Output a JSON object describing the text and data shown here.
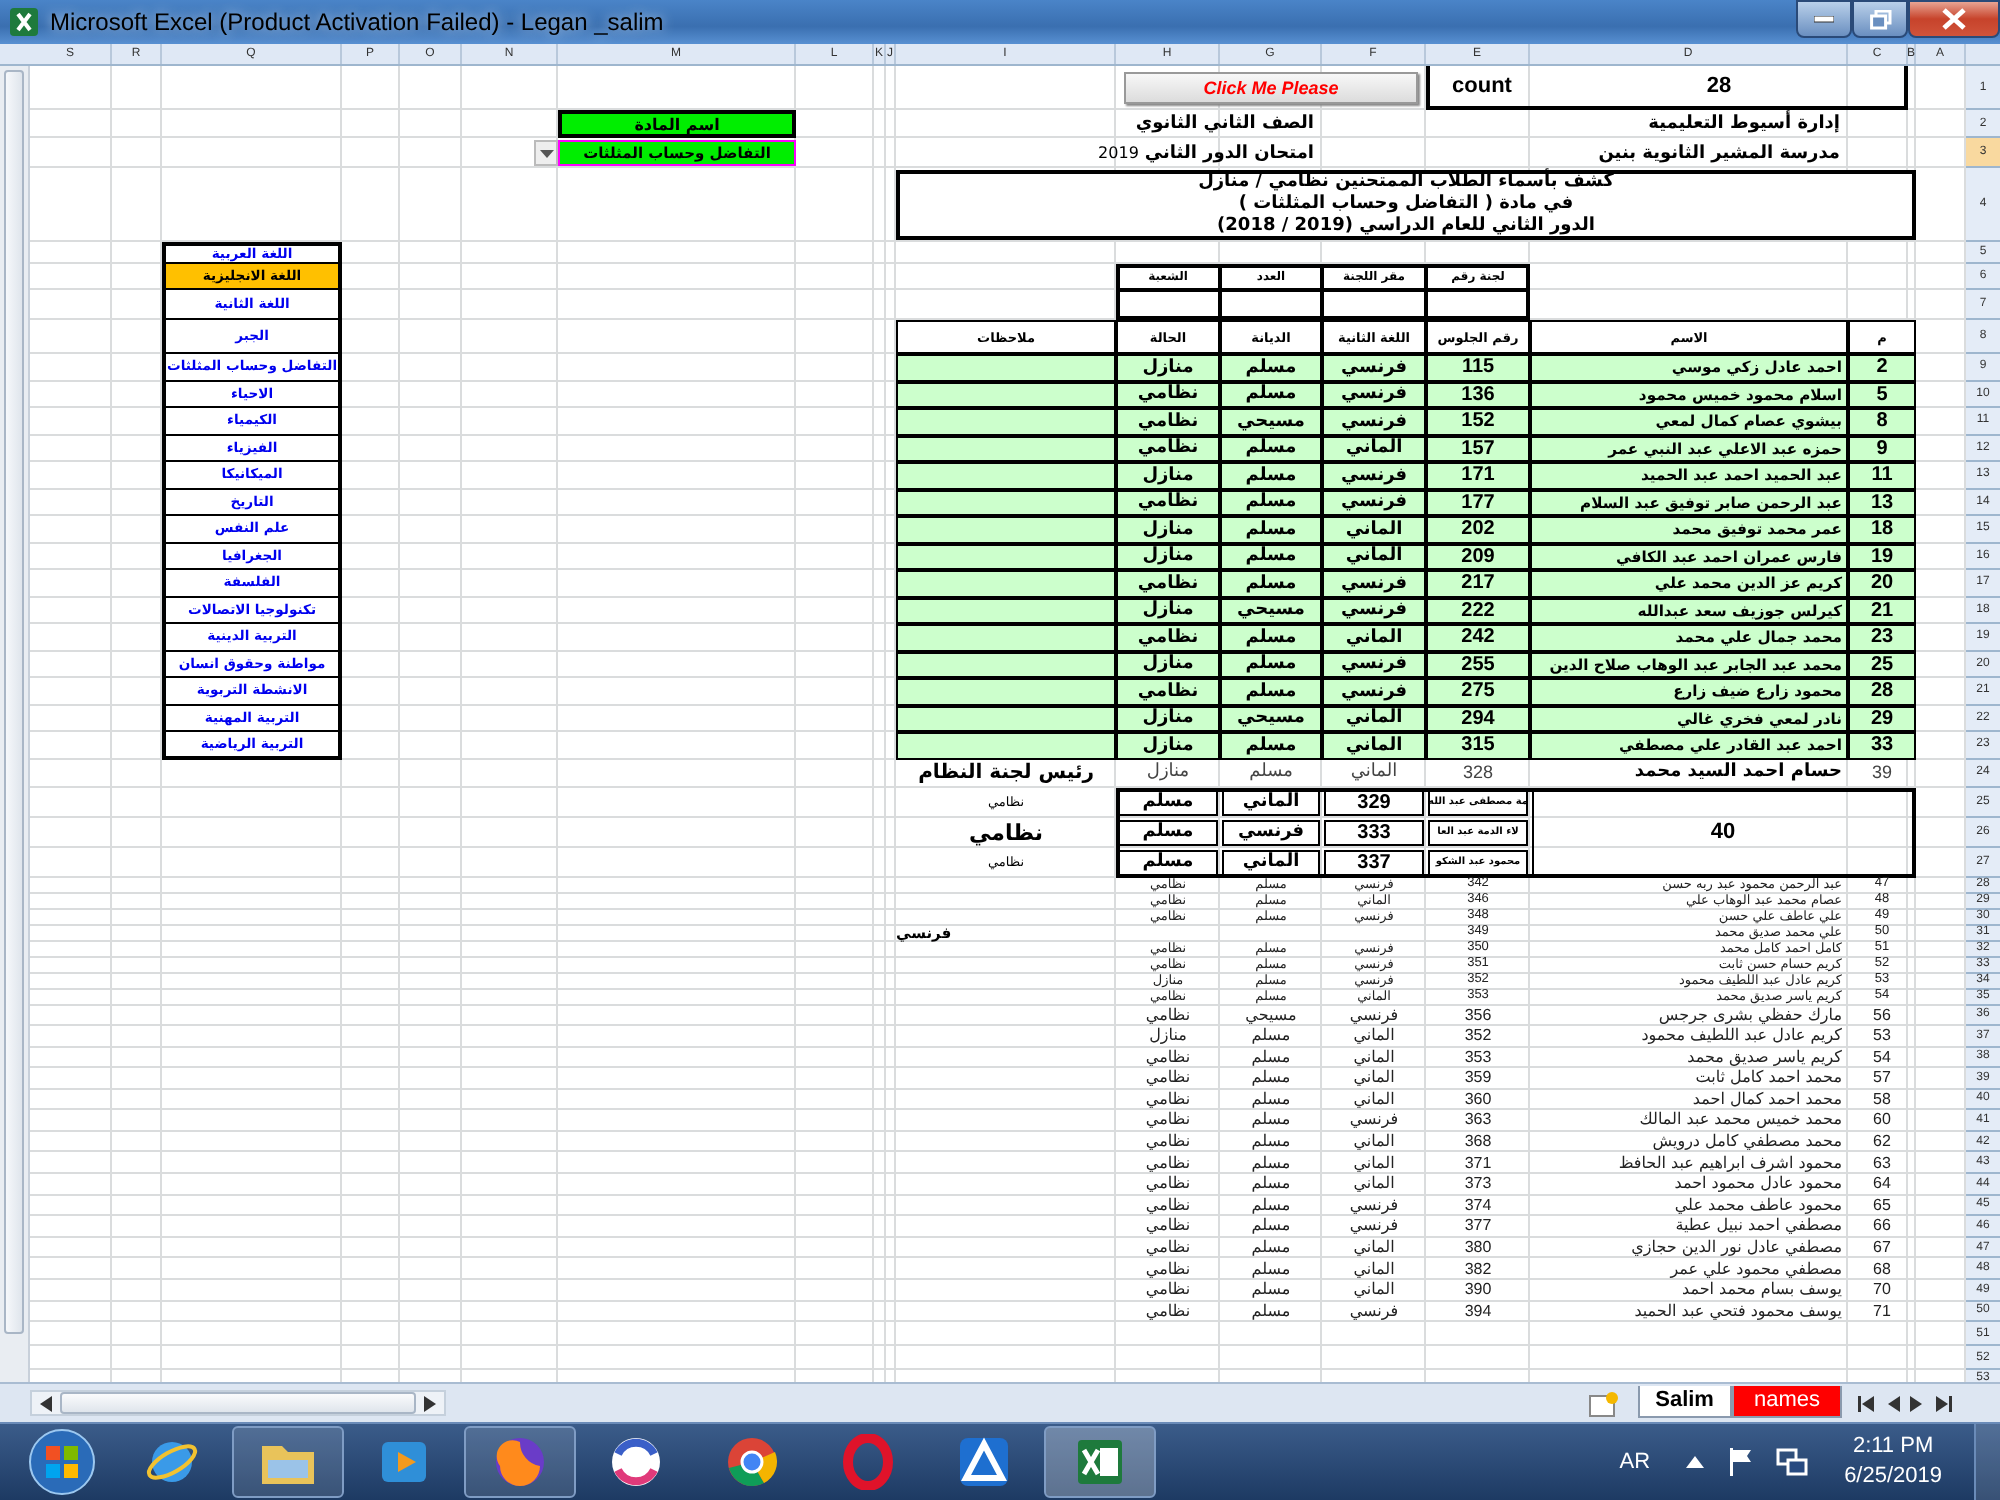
{
  "window": {
    "title": "Microsoft Excel (Product Activation Failed) - Legan _salim"
  },
  "columns": [
    "A",
    "B",
    "C",
    "D",
    "E",
    "F",
    "G",
    "H",
    "I",
    "J",
    "K",
    "L",
    "M",
    "N",
    "O",
    "P",
    "Q",
    "R",
    "S"
  ],
  "row_numbers": [
    {
      "label": "1",
      "selected": false
    },
    {
      "label": "2",
      "selected": false
    },
    {
      "label": "3",
      "selected": true
    },
    {
      "label": "4",
      "selected": false
    },
    {
      "label": "5",
      "selected": false
    },
    {
      "label": "6",
      "selected": false
    },
    {
      "label": "7",
      "selected": false
    },
    {
      "label": "8",
      "selected": false
    },
    {
      "label": "9",
      "selected": false
    },
    {
      "label": "10",
      "selected": false
    },
    {
      "label": "11",
      "selected": false
    },
    {
      "label": "12",
      "selected": false
    },
    {
      "label": "13",
      "selected": false
    },
    {
      "label": "14",
      "selected": false
    },
    {
      "label": "15",
      "selected": false
    },
    {
      "label": "16",
      "selected": false
    },
    {
      "label": "17",
      "selected": false
    },
    {
      "label": "18",
      "selected": false
    },
    {
      "label": "19",
      "selected": false
    },
    {
      "label": "20",
      "selected": false
    },
    {
      "label": "21",
      "selected": false
    },
    {
      "label": "22",
      "selected": false
    },
    {
      "label": "23",
      "selected": false
    },
    {
      "label": "24",
      "selected": false
    },
    {
      "label": "25",
      "selected": false
    },
    {
      "label": "26",
      "selected": false
    },
    {
      "label": "27",
      "selected": false
    },
    {
      "label": "28",
      "selected": false
    },
    {
      "label": "29",
      "selected": false
    },
    {
      "label": "30",
      "selected": false
    },
    {
      "label": "31",
      "selected": false
    },
    {
      "label": "32",
      "selected": false
    },
    {
      "label": "33",
      "selected": false
    },
    {
      "label": "34",
      "selected": false
    },
    {
      "label": "35",
      "selected": false
    },
    {
      "label": "36",
      "selected": false
    },
    {
      "label": "37",
      "selected": false
    },
    {
      "label": "38",
      "selected": false
    },
    {
      "label": "39",
      "selected": false
    },
    {
      "label": "40",
      "selected": false
    },
    {
      "label": "41",
      "selected": false
    },
    {
      "label": "42",
      "selected": false
    },
    {
      "label": "43",
      "selected": false
    },
    {
      "label": "44",
      "selected": false
    },
    {
      "label": "45",
      "selected": false
    },
    {
      "label": "46",
      "selected": false
    },
    {
      "label": "47",
      "selected": false
    },
    {
      "label": "48",
      "selected": false
    },
    {
      "label": "49",
      "selected": false
    },
    {
      "label": "50",
      "selected": false
    },
    {
      "label": "51",
      "selected": false
    },
    {
      "label": "52",
      "selected": false
    },
    {
      "label": "53",
      "selected": false
    }
  ],
  "button": {
    "label": "Click Me Please"
  },
  "count": {
    "label": "count",
    "value": "28"
  },
  "header": {
    "directorate": "إدارة أسيوط التعليمية",
    "school": "مدرسة المشير الثانوية بنين",
    "grade": "الصف الثاني الثانوي",
    "exam": "امتحان الدور الثاني",
    "exam_year": "2019"
  },
  "title_lines": [
    "كشف بأسماء الطلاب الممتحنين نظامي / منازل",
    "في مادة ( التفاضل وحساب المثلثات )",
    "الدور الثاني للعام الدراسي (2019 / 2018)"
  ],
  "subject_picker": {
    "label": "اسم المادة",
    "value": "التفاضل وحساب المثلثات"
  },
  "subjects": [
    {
      "label": "اللغة العربية",
      "selected": false
    },
    {
      "label": "اللغة الانجليزية",
      "selected": true
    },
    {
      "label": "اللغة الثانية",
      "selected": false
    },
    {
      "label": "الجبر",
      "selected": false
    },
    {
      "label": "التفاضل وحساب المثلثات",
      "selected": false
    },
    {
      "label": "الاحياء",
      "selected": false
    },
    {
      "label": "الكيمياء",
      "selected": false
    },
    {
      "label": "الفيزياء",
      "selected": false
    },
    {
      "label": "الميكانيكا",
      "selected": false
    },
    {
      "label": "التاريخ",
      "selected": false
    },
    {
      "label": "علم النفس",
      "selected": false
    },
    {
      "label": "الجغرافيا",
      "selected": false
    },
    {
      "label": "الفلسفة",
      "selected": false
    },
    {
      "label": "تكنولوجيا الاتصالات",
      "selected": false
    },
    {
      "label": "التربية الدينية",
      "selected": false
    },
    {
      "label": "مواطنة وحقوق انسان",
      "selected": false
    },
    {
      "label": "الانشطة التربوية",
      "selected": false
    },
    {
      "label": "التربية المهنية",
      "selected": false
    },
    {
      "label": "التربية الرياضية",
      "selected": false
    }
  ],
  "committee": {
    "columns": [
      "لجنة رقم",
      "مقر اللجنة",
      "العدد",
      "الشعبة"
    ]
  },
  "table": {
    "columns": [
      "م",
      "الاسم",
      "رقم الجلوس",
      "اللغة الثانية",
      "الديانة",
      "الحالة",
      "ملاحظات"
    ],
    "rows": [
      {
        "no": "2",
        "name": "احمد عادل زكي موسي",
        "seat": "115",
        "language": "فرنسي",
        "religion": "مسلم",
        "status": "منازل"
      },
      {
        "no": "5",
        "name": "اسلام محمود خميس محمود",
        "seat": "136",
        "language": "فرنسي",
        "religion": "مسلم",
        "status": "نظامي"
      },
      {
        "no": "8",
        "name": "بيشوي عصام كمال لمعي",
        "seat": "152",
        "language": "فرنسي",
        "religion": "مسيحي",
        "status": "نظامي"
      },
      {
        "no": "9",
        "name": "حمزه عبد الاعلي عبد النبي عمر",
        "seat": "157",
        "language": "الماني",
        "religion": "مسلم",
        "status": "نظامي"
      },
      {
        "no": "11",
        "name": "عبد الحميد احمد عبد الحميد",
        "seat": "171",
        "language": "فرنسي",
        "religion": "مسلم",
        "status": "منازل"
      },
      {
        "no": "13",
        "name": "عبد الرحمن صابر توفيق عبد السلام",
        "seat": "177",
        "language": "فرنسي",
        "religion": "مسلم",
        "status": "نظامي"
      },
      {
        "no": "18",
        "name": "عمر محمد توفيق محمد",
        "seat": "202",
        "language": "الماني",
        "religion": "مسلم",
        "status": "منازل"
      },
      {
        "no": "19",
        "name": "فارس عمران احمد عبد الكافي",
        "seat": "209",
        "language": "الماني",
        "religion": "مسلم",
        "status": "منازل"
      },
      {
        "no": "20",
        "name": "كريم عز الدين محمد علي",
        "seat": "217",
        "language": "فرنسي",
        "religion": "مسلم",
        "status": "نظامي"
      },
      {
        "no": "21",
        "name": "كيرلس جوزيف سعد عبدالله",
        "seat": "222",
        "language": "فرنسي",
        "religion": "مسيحي",
        "status": "منازل"
      },
      {
        "no": "23",
        "name": "محمد جمال علي محمد",
        "seat": "242",
        "language": "الماني",
        "religion": "مسلم",
        "status": "نظامي"
      },
      {
        "no": "25",
        "name": "محمد عبد الجابر عبد الوهاب صلاح الدين",
        "seat": "255",
        "language": "فرنسي",
        "religion": "مسلم",
        "status": "منازل"
      },
      {
        "no": "28",
        "name": "محمود زارع ضيف زارع",
        "seat": "275",
        "language": "فرنسي",
        "religion": "مسلم",
        "status": "نظامي"
      },
      {
        "no": "29",
        "name": "نادر لمعي فخري غالي",
        "seat": "294",
        "language": "الماني",
        "religion": "مسيحي",
        "status": "منازل"
      },
      {
        "no": "33",
        "name": "احمد عبد القادر علي مصطفي",
        "seat": "315",
        "language": "الماني",
        "religion": "مسلم",
        "status": "منازل"
      }
    ]
  },
  "extra_row": {
    "no": "39",
    "name": "حسام احمد السيد محمد",
    "seat": "328",
    "language": "الماني",
    "religion": "مسلم",
    "status": "منازل",
    "note": "رئيس لجنة النظام"
  },
  "box": {
    "count": "40",
    "rows": [
      {
        "name": "مة مصطفى عبد الله",
        "seat": "329",
        "language": "الماني",
        "religion": "مسلم",
        "note": "نظامي",
        "emphasis": false
      },
      {
        "name": "لاء الدمة عبد العا",
        "seat": "333",
        "language": "فرنسي",
        "religion": "مسلم",
        "note": "نظامي",
        "emphasis": true
      },
      {
        "name": "محمود عبد الشكو",
        "seat": "337",
        "language": "الماني",
        "religion": "مسلم",
        "note": "نظامي",
        "emphasis": false
      }
    ]
  },
  "lower_rows": [
    {
      "no": "47",
      "name": "عبد الرحمن محمود عبد ربه حسن",
      "seat": "342",
      "language": "فرنسي",
      "religion": "مسلم",
      "status": "نظامي"
    },
    {
      "no": "48",
      "name": "عصام محمد عبد الوهاب علي",
      "seat": "346",
      "language": "الماني",
      "religion": "مسلم",
      "status": "نظامي"
    },
    {
      "no": "49",
      "name": "علي عاطف علي حسن",
      "seat": "348",
      "language": "فرنسي",
      "religion": "مسلم",
      "status": "نظامي"
    },
    {
      "no": "50",
      "name": "علي محمد صديق محمد",
      "seat": "349",
      "note": "فرنسي"
    },
    {
      "no": "51",
      "name": "كامل احمد كامل محمد",
      "seat": "350",
      "language": "فرنسي",
      "religion": "مسلم",
      "status": "نظامي"
    },
    {
      "no": "52",
      "name": "كريم حسام حسن ثابت",
      "seat": "351",
      "language": "فرنسي",
      "religion": "مسلم",
      "status": "نظامي"
    },
    {
      "no": "53",
      "name": "كريم عادل عبد اللطيف محمود",
      "seat": "352",
      "language": "فرنسي",
      "religion": "مسلم",
      "status": "منازل"
    },
    {
      "no": "54",
      "name": "كريم ياسر صديق محمد",
      "seat": "353",
      "language": "الماني",
      "religion": "مسلم",
      "status": "نظامي"
    },
    {
      "no": "56",
      "name": "مارك حفظي بشرى جرجس",
      "seat": "356",
      "language": "فرنسي",
      "religion": "مسيحي",
      "status": "نظامي"
    },
    {
      "no": "53",
      "name": "كريم عادل عبد اللطيف محمود",
      "seat": "352",
      "language": "الماني",
      "religion": "مسلم",
      "status": "منازل"
    },
    {
      "no": "54",
      "name": "كريم ياسر صديق محمد",
      "seat": "353",
      "language": "الماني",
      "religion": "مسلم",
      "status": "نظامي"
    },
    {
      "no": "57",
      "name": "محمد احمد كامل ثابت",
      "seat": "359",
      "language": "الماني",
      "religion": "مسلم",
      "status": "نظامي"
    },
    {
      "no": "58",
      "name": "محمد احمد كمال احمد",
      "seat": "360",
      "language": "الماني",
      "religion": "مسلم",
      "status": "نظامي"
    },
    {
      "no": "60",
      "name": "محمد خميس محمد عبد المالك",
      "seat": "363",
      "language": "فرنسي",
      "religion": "مسلم",
      "status": "نظامي"
    },
    {
      "no": "62",
      "name": "محمد مصطفي كامل درويش",
      "seat": "368",
      "language": "الماني",
      "religion": "مسلم",
      "status": "نظامي"
    },
    {
      "no": "63",
      "name": "محمود اشرف ابراهيم عبد الحافظ",
      "seat": "371",
      "language": "الماني",
      "religion": "مسلم",
      "status": "نظامي"
    },
    {
      "no": "64",
      "name": "محمود عادل محمود احمد",
      "seat": "373",
      "language": "الماني",
      "religion": "مسلم",
      "status": "نظامي"
    },
    {
      "no": "65",
      "name": "محمود عاطف محمد علي",
      "seat": "374",
      "language": "فرنسي",
      "religion": "مسلم",
      "status": "نظامي"
    },
    {
      "no": "66",
      "name": "مصطفي احمد نبيل عطية",
      "seat": "377",
      "language": "فرنسي",
      "religion": "مسلم",
      "status": "نظامي"
    },
    {
      "no": "67",
      "name": "مصطفي عادل نور الدين حجازي",
      "seat": "380",
      "language": "الماني",
      "religion": "مسلم",
      "status": "نظامي"
    },
    {
      "no": "68",
      "name": "مصطفي محمود علي عمر",
      "seat": "382",
      "language": "الماني",
      "religion": "مسلم",
      "status": "نظامي"
    },
    {
      "no": "70",
      "name": "يوسف بسام محمد احمد",
      "seat": "390",
      "language": "الماني",
      "religion": "مسلم",
      "status": "نظامي"
    },
    {
      "no": "71",
      "name": "يوسف محمود فتحي عبد الحميد",
      "seat": "394",
      "language": "فرنسي",
      "religion": "مسلم",
      "status": "نظامي"
    }
  ],
  "sheet_tabs": [
    {
      "label": "names",
      "selected": false,
      "color": "#ff0000"
    },
    {
      "label": "Salim",
      "selected": true,
      "color": "#ffffff"
    }
  ],
  "taskbar": {
    "language": "AR",
    "time": "2:11 PM",
    "date": "6/25/2019"
  }
}
